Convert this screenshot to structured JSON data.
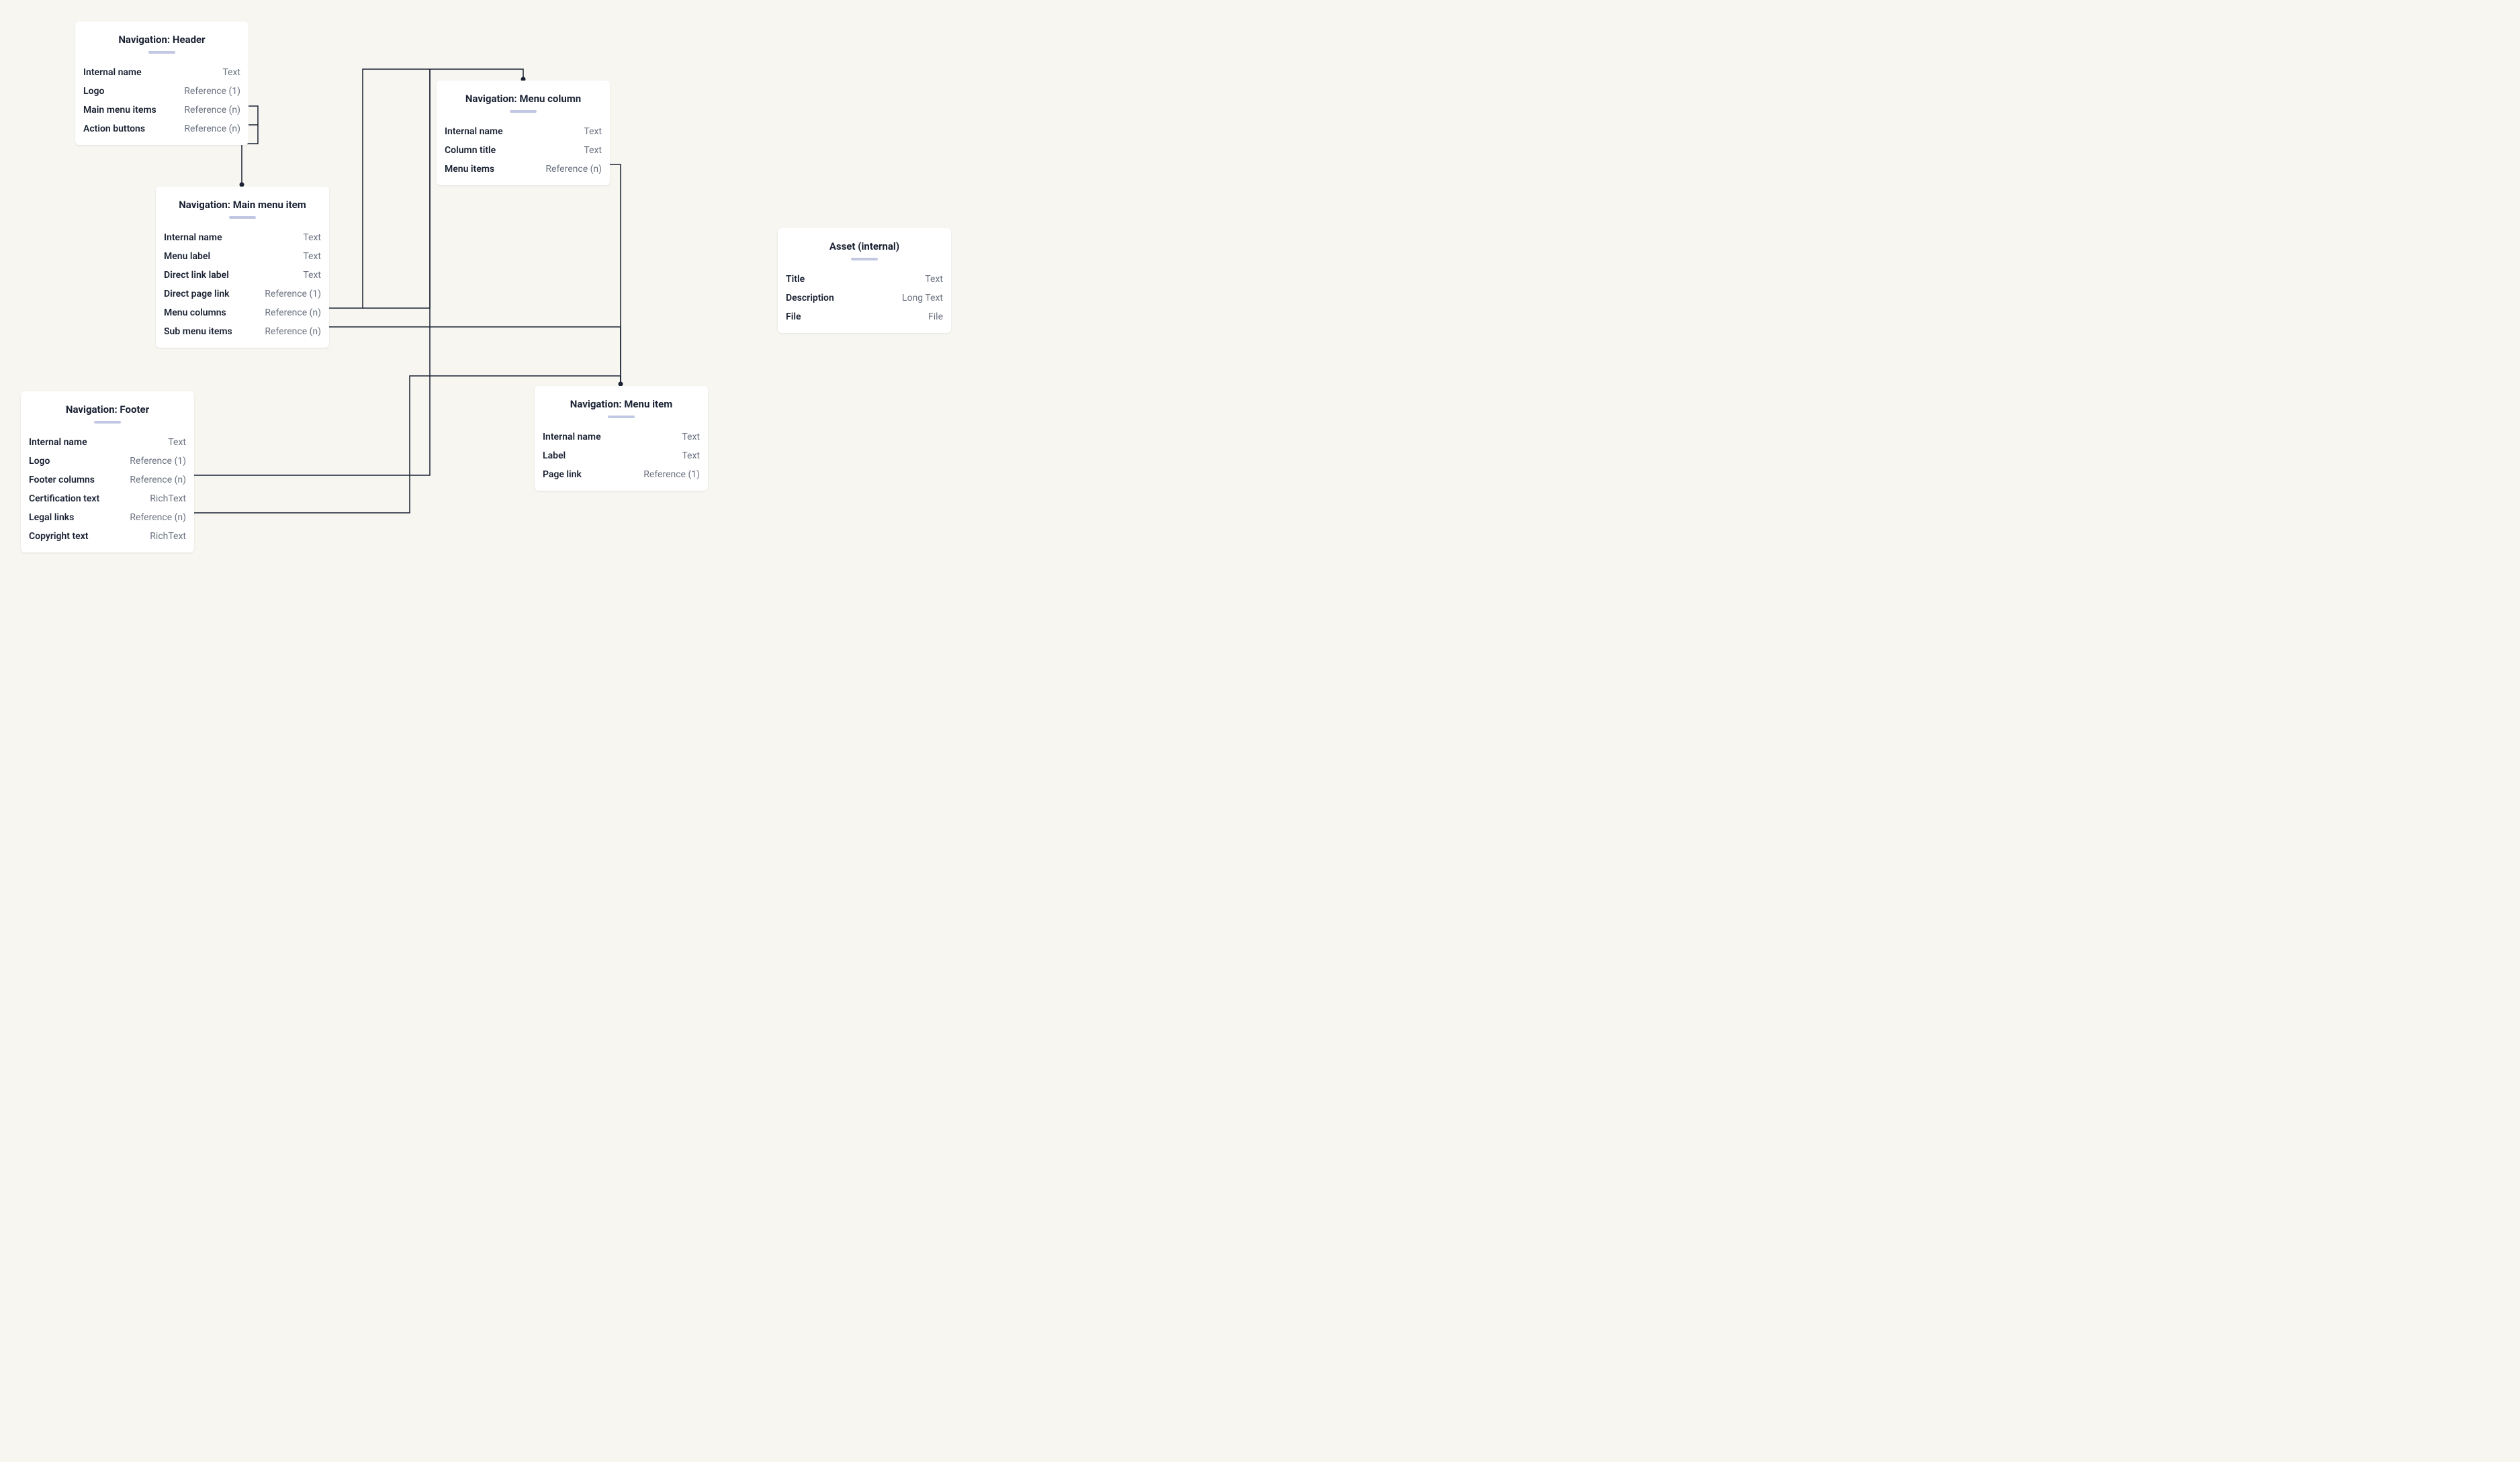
{
  "cards": {
    "header": {
      "title": "Navigation: Header",
      "fields": [
        {
          "name": "Internal name",
          "type": "Text"
        },
        {
          "name": "Logo",
          "type": "Reference (1)"
        },
        {
          "name": "Main menu items",
          "type": "Reference (n)"
        },
        {
          "name": "Action buttons",
          "type": "Reference (n)"
        }
      ]
    },
    "main_menu_item": {
      "title": "Navigation: Main menu item",
      "fields": [
        {
          "name": "Internal name",
          "type": "Text"
        },
        {
          "name": "Menu label",
          "type": "Text"
        },
        {
          "name": "Direct link label",
          "type": "Text"
        },
        {
          "name": "Direct page link",
          "type": "Reference (1)"
        },
        {
          "name": "Menu columns",
          "type": "Reference (n)"
        },
        {
          "name": "Sub menu items",
          "type": "Reference (n)"
        }
      ]
    },
    "menu_column": {
      "title": "Navigation: Menu column",
      "fields": [
        {
          "name": "Internal name",
          "type": "Text"
        },
        {
          "name": "Column title",
          "type": "Text"
        },
        {
          "name": "Menu items",
          "type": "Reference (n)"
        }
      ]
    },
    "menu_item": {
      "title": "Navigation: Menu item",
      "fields": [
        {
          "name": "Internal name",
          "type": "Text"
        },
        {
          "name": "Label",
          "type": "Text"
        },
        {
          "name": "Page link",
          "type": "Reference (1)"
        }
      ]
    },
    "footer": {
      "title": "Navigation: Footer",
      "fields": [
        {
          "name": "Internal name",
          "type": "Text"
        },
        {
          "name": "Logo",
          "type": "Reference (1)"
        },
        {
          "name": "Footer columns",
          "type": "Reference (n)"
        },
        {
          "name": "Certification text",
          "type": "RichText"
        },
        {
          "name": "Legal links",
          "type": "Reference (n)"
        },
        {
          "name": "Copyright text",
          "type": "RichText"
        }
      ]
    },
    "asset": {
      "title": "Asset (internal)",
      "fields": [
        {
          "name": "Title",
          "type": "Text"
        },
        {
          "name": "Description",
          "type": "Long Text"
        },
        {
          "name": "File",
          "type": "File"
        }
      ]
    }
  }
}
